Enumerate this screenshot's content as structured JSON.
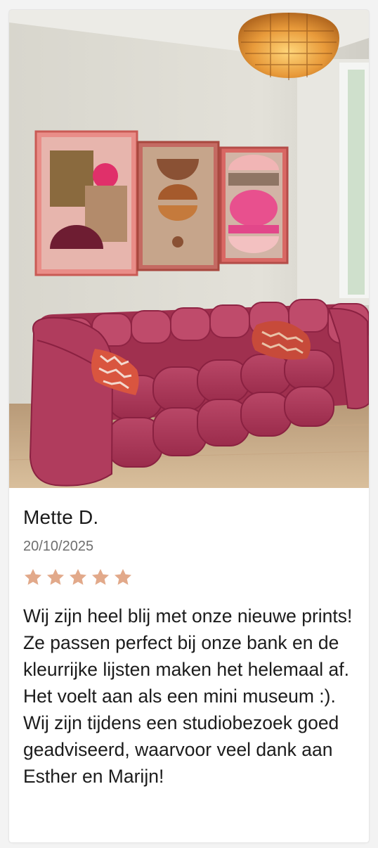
{
  "review": {
    "reviewer_name": "Mette D.",
    "date": "20/10/2025",
    "rating": 5,
    "rating_max": 5,
    "text": "Wij zijn heel blij met onze nieuwe prints! Ze passen perfect bij onze bank en de kleurrijke lijsten maken het helemaal af. Het voelt aan als een mini museum :). Wij zijn tijdens een studiobezoek goed geadviseerd, waarvoor veel dank aan Esther en Marijn!"
  },
  "colors": {
    "star": "#e2a98a",
    "sofa": "#b23a5c",
    "wall": "#dedbd2",
    "frame": "#d9685c"
  },
  "icons": {
    "star": "star-icon"
  }
}
